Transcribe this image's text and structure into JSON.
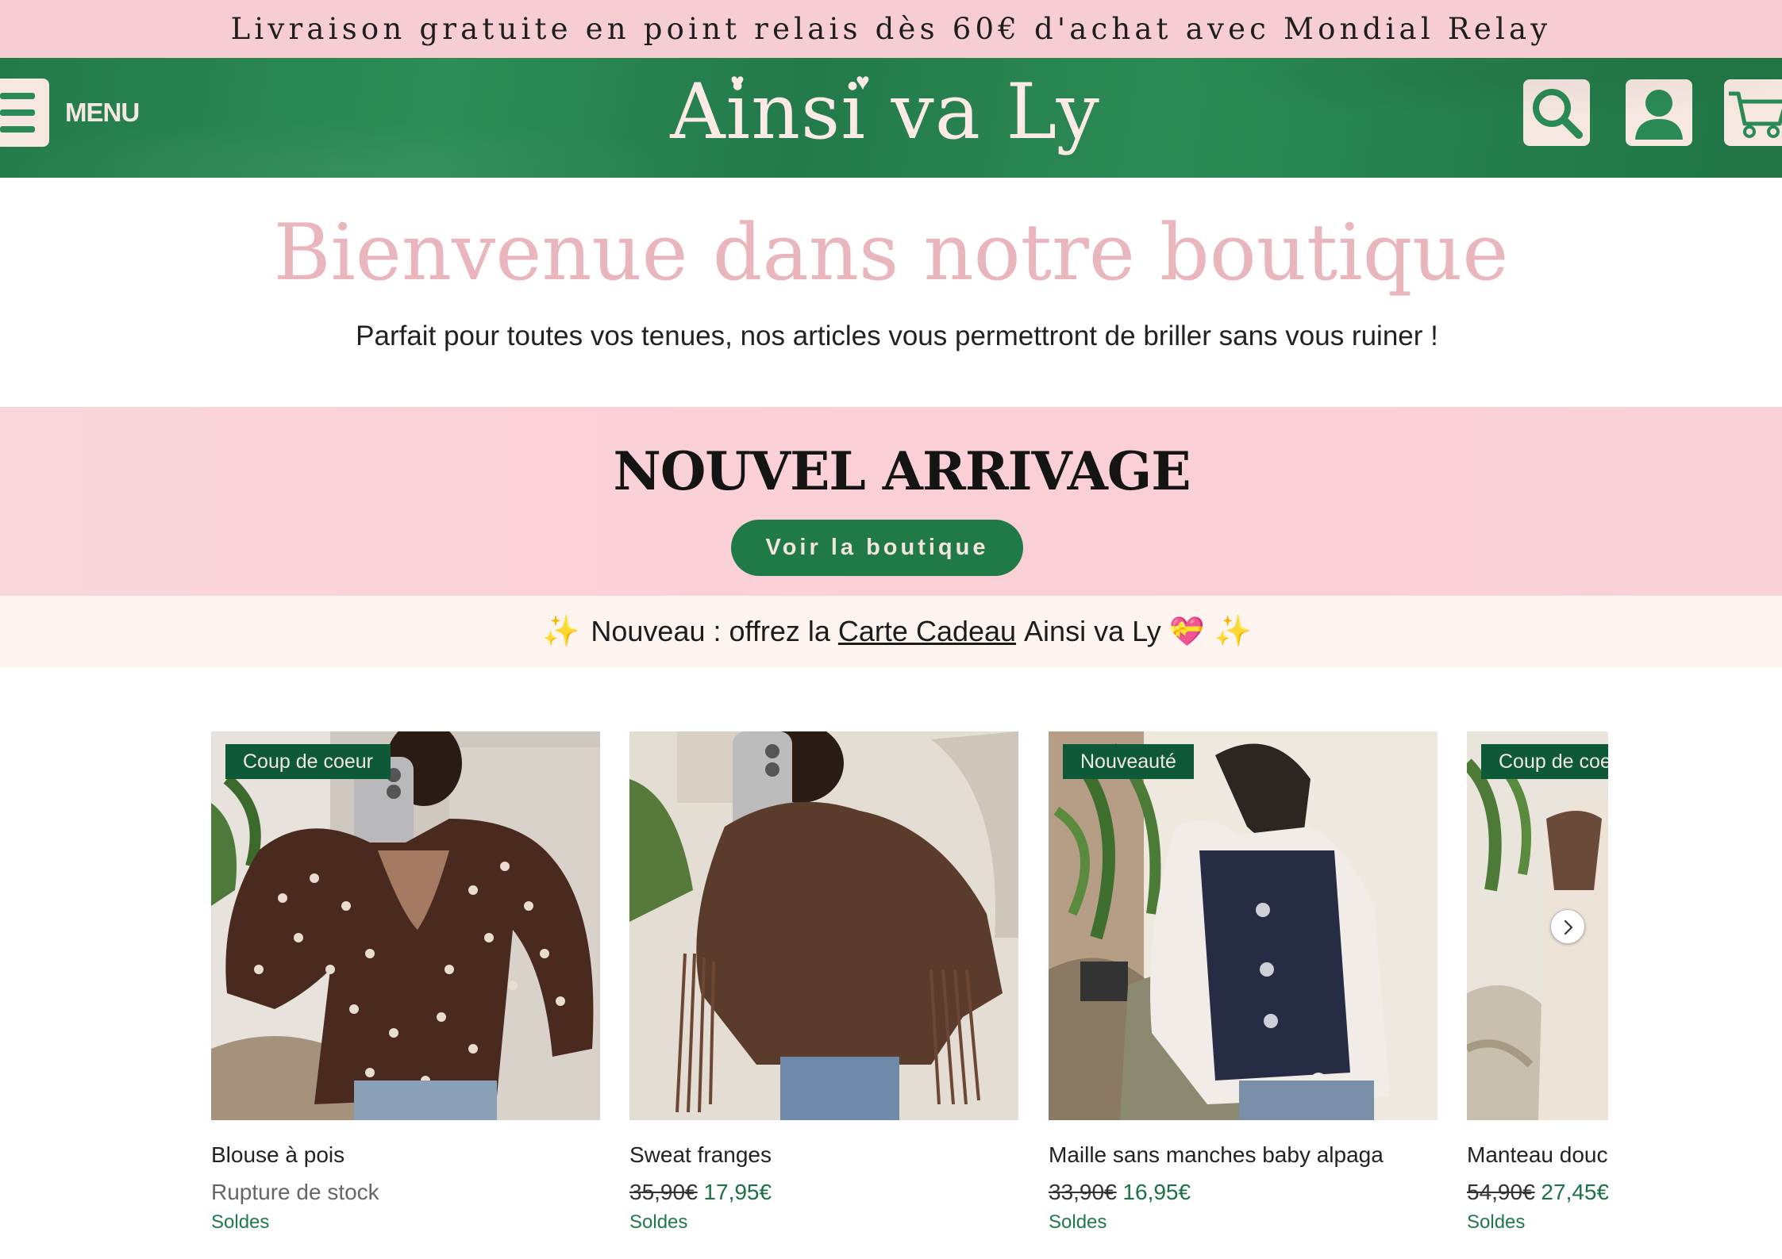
{
  "announcement": "Livraison gratuite en point relais dès 60€ d'achat avec Mondial Relay",
  "header": {
    "menu_label": "MENU",
    "logo": "Ainsi va Ly",
    "icons": [
      "menu-icon",
      "search-icon",
      "account-icon",
      "cart-icon"
    ],
    "colors": {
      "green": "#237a4a",
      "cream": "#f6e7e1"
    }
  },
  "welcome": {
    "title": "Bienvenue dans notre boutique",
    "subtitle": "Parfait pour toutes vos tenues, nos articles vous permettront de briller sans vous ruiner !"
  },
  "banner": {
    "title": "NOUVEL ARRIVAGE",
    "button": "Voir la boutique"
  },
  "promo": {
    "prefix": "Nouveau : offrez la",
    "link": "Carte Cadeau",
    "suffix": "Ainsi va Ly",
    "icons": [
      "sparkles-icon",
      "heart-ribbon-icon",
      "sparkles-icon"
    ]
  },
  "products": [
    {
      "badge": "Coup de coeur",
      "name": "Blouse à pois",
      "old_price": "",
      "new_price": "",
      "stock": "Rupture de stock",
      "tag": "Soldes"
    },
    {
      "badge": "",
      "name": "Sweat franges",
      "old_price": "35,90€",
      "new_price": "17,95€",
      "stock": "",
      "tag": "Soldes"
    },
    {
      "badge": "Nouveauté",
      "name": "Maille sans manches baby alpaga",
      "old_price": "33,90€",
      "new_price": "16,95€",
      "stock": "",
      "tag": "Soldes"
    },
    {
      "badge": "Coup de coeur",
      "name": "Manteau douc",
      "old_price": "54,90€",
      "new_price": "27,45€",
      "stock": "",
      "tag": "Soldes"
    }
  ]
}
